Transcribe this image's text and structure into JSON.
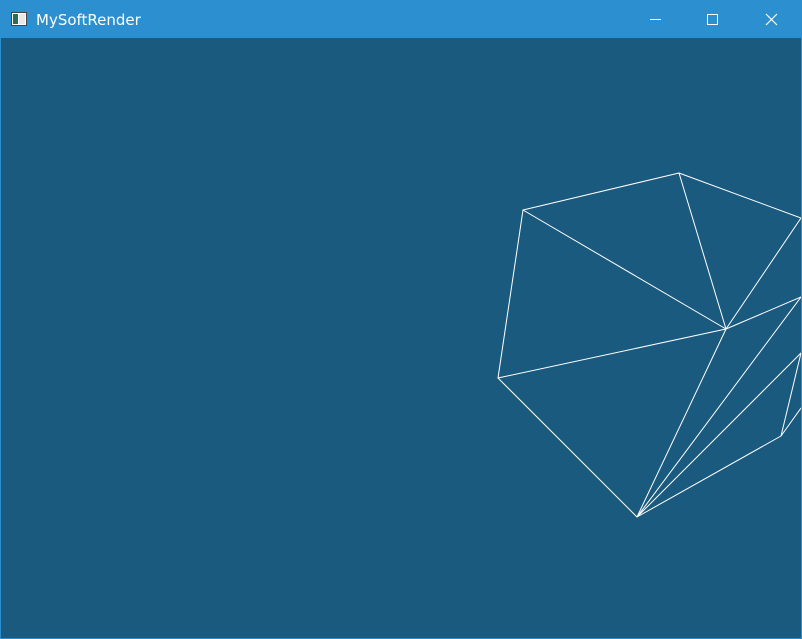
{
  "window": {
    "title": "MySoftRender",
    "titlebar_color": "#2b8fd0",
    "background_color": "#1b5a7f",
    "icons": {
      "app": "app-window-icon",
      "minimize": "minimize-icon",
      "maximize": "maximize-icon",
      "close": "close-icon"
    }
  },
  "render": {
    "mode": "wireframe",
    "line_color": "#ffffff"
  }
}
